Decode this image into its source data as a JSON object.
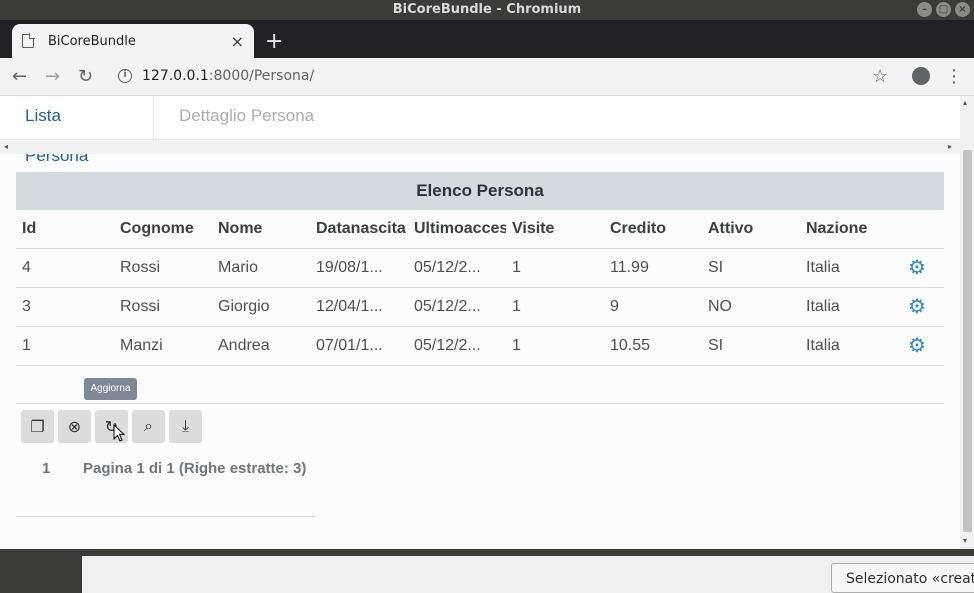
{
  "os": {
    "window_title": "BiCoreBundle - Chromium",
    "min": "–",
    "max": "□",
    "close": "×"
  },
  "browser": {
    "tab_title": "BiCoreBundle",
    "tab_close": "×",
    "new_tab": "+",
    "back": "←",
    "forward": "→",
    "reload": "↻",
    "info": "i",
    "url_host": "127.0.0.1",
    "url_path": ":8000/Persona/",
    "star": "☆",
    "menu": "⋮"
  },
  "page": {
    "tabs": [
      {
        "label": "Lista Persona"
      },
      {
        "label": "Dettaglio Persona"
      }
    ],
    "grid_title": "Elenco Persona",
    "columns": [
      "Id",
      "Cognome",
      "Nome",
      "Datanascita",
      "Ultimoaccesso",
      "Visite",
      "Credito",
      "Attivo",
      "Nazione"
    ],
    "rows": [
      {
        "id": "4",
        "cognome": "Rossi",
        "nome": "Mario",
        "datanascita": "19/08/1...",
        "ultimoaccesso": "05/12/2...",
        "visite": "1",
        "credito": "11.99",
        "attivo": "SI",
        "nazione": "Italia"
      },
      {
        "id": "3",
        "cognome": "Rossi",
        "nome": "Giorgio",
        "datanascita": "12/04/1...",
        "ultimoaccesso": "05/12/2...",
        "visite": "1",
        "credito": "9",
        "attivo": "NO",
        "nazione": "Italia"
      },
      {
        "id": "1",
        "cognome": "Manzi",
        "nome": "Andrea",
        "datanascita": "07/01/1...",
        "ultimoaccesso": "05/12/2...",
        "visite": "1",
        "credito": "10.55",
        "attivo": "SI",
        "nazione": "Italia"
      }
    ],
    "gear_icon": "⚙",
    "tooltip": "Aggiorna",
    "toolbar_icons": [
      "❐",
      "⊗",
      "↻",
      "⌕",
      "⤓"
    ],
    "pager_current": "1",
    "pager_info": "Pagina 1 di 1 (Righe estratte: 3)",
    "scroll_left": "◂",
    "scroll_right": "▸",
    "scroll_up": "▴",
    "scroll_down": "▾"
  },
  "taskbar": {
    "button_label": "Selezionato «create"
  }
}
